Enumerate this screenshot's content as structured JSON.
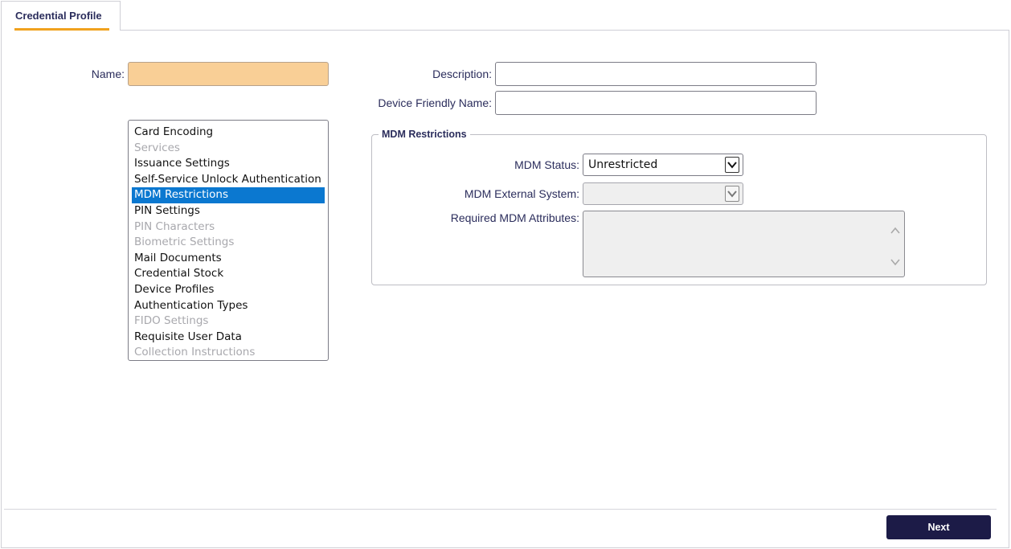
{
  "tab": {
    "label": "Credential Profile"
  },
  "form": {
    "name_label": "Name:",
    "name_value": "",
    "description_label": "Description:",
    "description_value": "",
    "device_friendly_name_label": "Device Friendly Name:",
    "device_friendly_name_value": ""
  },
  "sections_list": {
    "items": [
      {
        "label": "Card Encoding",
        "state": "enabled"
      },
      {
        "label": "Services",
        "state": "disabled"
      },
      {
        "label": "Issuance Settings",
        "state": "enabled"
      },
      {
        "label": "Self-Service Unlock Authentication",
        "state": "enabled"
      },
      {
        "label": "MDM Restrictions",
        "state": "selected"
      },
      {
        "label": "PIN Settings",
        "state": "enabled"
      },
      {
        "label": "PIN Characters",
        "state": "disabled"
      },
      {
        "label": "Biometric Settings",
        "state": "disabled"
      },
      {
        "label": "Mail Documents",
        "state": "enabled"
      },
      {
        "label": "Credential Stock",
        "state": "enabled"
      },
      {
        "label": "Device Profiles",
        "state": "enabled"
      },
      {
        "label": "Authentication Types",
        "state": "enabled"
      },
      {
        "label": "FIDO Settings",
        "state": "disabled"
      },
      {
        "label": "Requisite User Data",
        "state": "enabled"
      },
      {
        "label": "Collection Instructions",
        "state": "disabled"
      }
    ]
  },
  "mdm": {
    "legend": "MDM Restrictions",
    "status_label": "MDM Status:",
    "status_value": "Unrestricted",
    "external_system_label": "MDM External System:",
    "external_system_value": "",
    "required_attributes_label": "Required MDM Attributes:",
    "required_attributes_value": ""
  },
  "footer": {
    "next_label": "Next"
  },
  "colors": {
    "accent_orange": "#f0a21e",
    "name_field_bg": "#f9cf96",
    "selected_item_bg": "#0b78d0",
    "primary_button_bg": "#1c1b47",
    "label_text": "#2b2d5c"
  }
}
